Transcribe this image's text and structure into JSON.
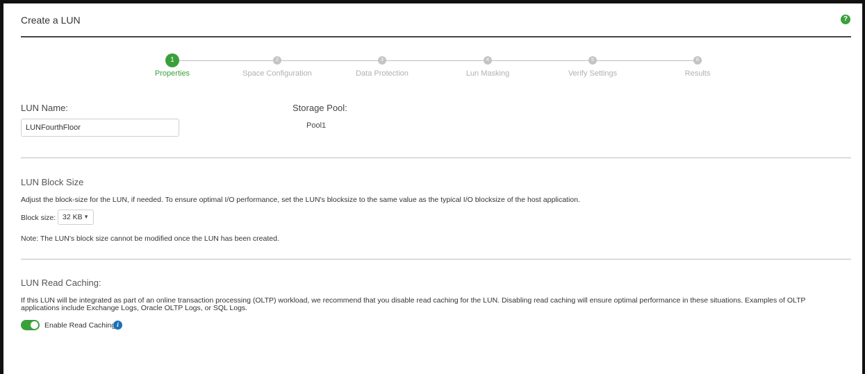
{
  "header": {
    "title": "Create a LUN",
    "help_icon": "question-circle-icon",
    "help_symbol": "?"
  },
  "stepper": {
    "steps": [
      {
        "number": "1",
        "label": "Properties"
      },
      {
        "number": "2",
        "label": "Space Configuration"
      },
      {
        "number": "3",
        "label": "Data Protection"
      },
      {
        "number": "4",
        "label": "Lun Masking"
      },
      {
        "number": "5",
        "label": "Verify Settings"
      },
      {
        "number": "6",
        "label": "Results"
      }
    ],
    "active_step": 1
  },
  "properties": {
    "lun_name_label": "LUN Name:",
    "lun_name_value": "LUNFourthFloor",
    "storage_pool_label": "Storage Pool:",
    "storage_pool_value": "Pool1"
  },
  "block_size": {
    "title": "LUN Block Size",
    "description": "Adjust the block-size for the LUN, if needed. To ensure optimal I/O performance, set the LUN's blocksize to the same value as the typical I/O blocksize of the host application.",
    "label": "Block size:",
    "selected": "32 KB",
    "note": "Note: The LUN's block size cannot be modified once the LUN has been created."
  },
  "read_caching": {
    "title": "LUN Read Caching:",
    "description": "If this LUN will be integrated as part of an online transaction processing (OLTP) workload, we recommend that you disable read caching for the LUN. Disabling read caching will ensure optimal performance in these situations. Examples of OLTP applications include Exchange Logs, Oracle OLTP Logs, or SQL Logs.",
    "toggle_label": "Enable Read Caching",
    "enabled": true,
    "info_icon": "info-circle-icon",
    "info_symbol": "i"
  },
  "colors": {
    "accent": "#3aa03a",
    "info": "#1f6fb8",
    "inactive_step": "#c4c4c4"
  }
}
